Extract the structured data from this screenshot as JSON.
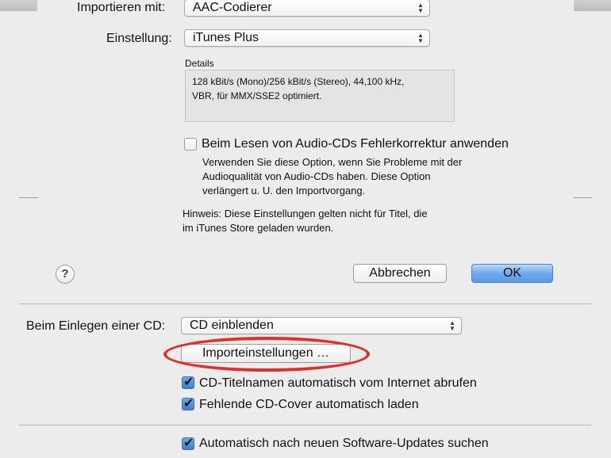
{
  "import_dialog": {
    "import_with_label": "Importieren mit:",
    "import_with_value": "AAC-Codierer",
    "setting_label": "Einstellung:",
    "setting_value": "iTunes Plus",
    "details_label": "Details",
    "details_line1": "128 kBit/s (Mono)/256 kBit/s (Stereo), 44,100 kHz,",
    "details_line2": "VBR, für MMX/SSE2 optimiert.",
    "error_correction_label": "Beim Lesen von Audio-CDs Fehlerkorrektur anwenden",
    "error_correction_checked": false,
    "error_correction_help_line1": "Verwenden Sie diese Option, wenn Sie Probleme mit der",
    "error_correction_help_line2": "Audioqualität von Audio-CDs haben. Diese Option",
    "error_correction_help_line3": "verlängert u. U. den Importvorgang.",
    "note_line1": "Hinweis: Diese Einstellungen gelten nicht für Titel, die",
    "note_line2": "im iTunes Store geladen wurden.",
    "help_symbol": "?",
    "cancel_label": "Abbrechen",
    "ok_label": "OK"
  },
  "general_prefs": {
    "insert_cd_label": "Beim Einlegen einer CD:",
    "insert_cd_value": "CD einblenden",
    "import_settings_label": "Importeinstellungen …",
    "cd_names_label": "CD-Titelnamen automatisch vom Internet abrufen",
    "cd_names_checked": true,
    "cd_cover_label": "Fehlende CD-Cover automatisch laden",
    "cd_cover_checked": true,
    "updates_label": "Automatisch nach neuen Software-Updates suchen",
    "updates_checked": true
  },
  "colors": {
    "highlight_oval": "#e0302b",
    "default_button": "#6fa9ec",
    "checkbox_checked": "#3b7fd3"
  }
}
